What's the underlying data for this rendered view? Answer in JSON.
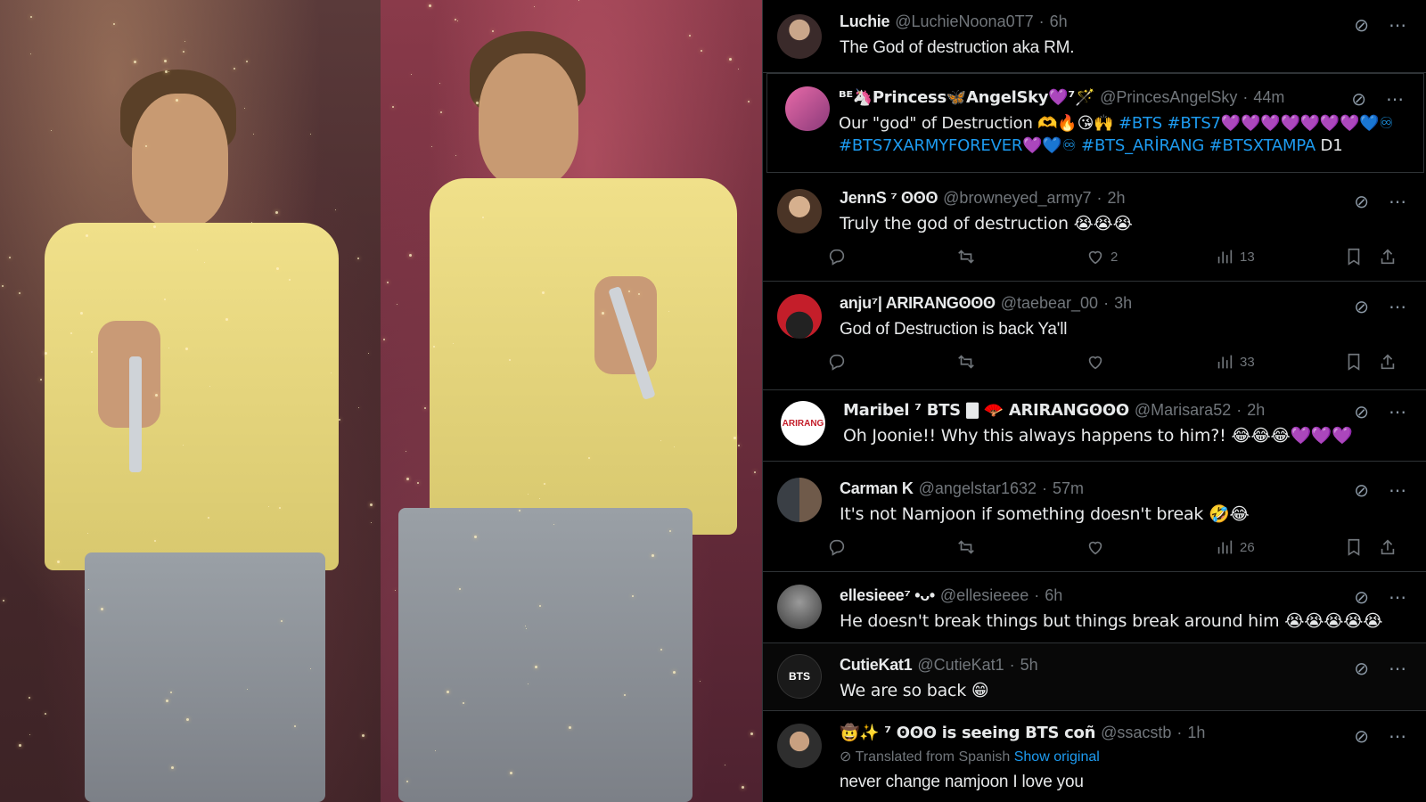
{
  "posts": [
    {
      "name": "Luchie",
      "handle": "@LuchieNoona0T7",
      "time": "6h",
      "text": "The God of destruction aka RM.",
      "avatar_color": "#3a2a2a"
    },
    {
      "name": "ᴮᴱ🦄Princess🦋AngelSky💜⁷🪄",
      "handle": "@PrincesAngelSky",
      "time": "44m",
      "text_plain": "Our \"god\" of Destruction 🫶🔥😘🙌",
      "text_tags_1": "#BTS #BTS7💜💜💜💜💜💜💜💙♾",
      "text_tags_2": "#BTS7XARMYFOREVER💜💙♾ #BTS_ARİRANG #BTSXTAMPA",
      "text_tail": "D1",
      "avatar_color": "#d7589a"
    },
    {
      "name": "JennS ⁷ ʘʘʘ",
      "handle": "@browneyed_army7",
      "time": "2h",
      "text": "Truly the god of destruction 😭😭😭",
      "likes": "2",
      "views": "13",
      "avatar_color": "#6a5040"
    },
    {
      "name": "anju⁷| ARIRANGʘʘʘ",
      "handle": "@taebear_00",
      "time": "3h",
      "text": "God of Destruction is back Ya'll",
      "likes": "",
      "views": "33",
      "avatar_color": "#c41e2a"
    },
    {
      "name": "Maribel ⁷ BTS 🀫 🪭 ARIRANGʘʘʘ",
      "handle": "@Marisara52",
      "time": "2h",
      "text": "Oh Joonie!! Why this always happens to him?! 😂😂😂💜💜💜",
      "avatar_color": "#ffffff",
      "avatar_label": "ARIRANG"
    },
    {
      "name": "Carman K",
      "handle": "@angelstar1632",
      "time": "57m",
      "text": "It's not Namjoon if something doesn't break 🤣😂",
      "likes": "",
      "views": "26",
      "avatar_color": "#55606a"
    },
    {
      "name": "ellesieee⁷ •ᴗ•",
      "handle": "@ellesieeee",
      "time": "6h",
      "text": "He doesn't break things but things break around him 😭😭😭😭😭",
      "avatar_color": "#6d6d6d"
    },
    {
      "name": "CutieKat1",
      "handle": "@CutieKat1",
      "time": "5h",
      "text": "We are so back 😁",
      "avatar_color": "#1a1a1a",
      "avatar_label": "BTS"
    },
    {
      "name": "🤠✨ ⁷ ʘʘʘ is seeing BTS coñ",
      "handle": "@ssacstb",
      "time": "1h",
      "translated_label": "Translated from Spanish",
      "show_original": "Show original",
      "text": "never change namjoon I love you",
      "avatar_color": "#3b3b3b"
    }
  ],
  "icons": {
    "grok": "grok-icon",
    "more": "more-icon",
    "reply": "reply-icon",
    "repost": "repost-icon",
    "like": "like-icon",
    "views": "views-icon",
    "bookmark": "bookmark-icon",
    "share": "share-icon"
  }
}
